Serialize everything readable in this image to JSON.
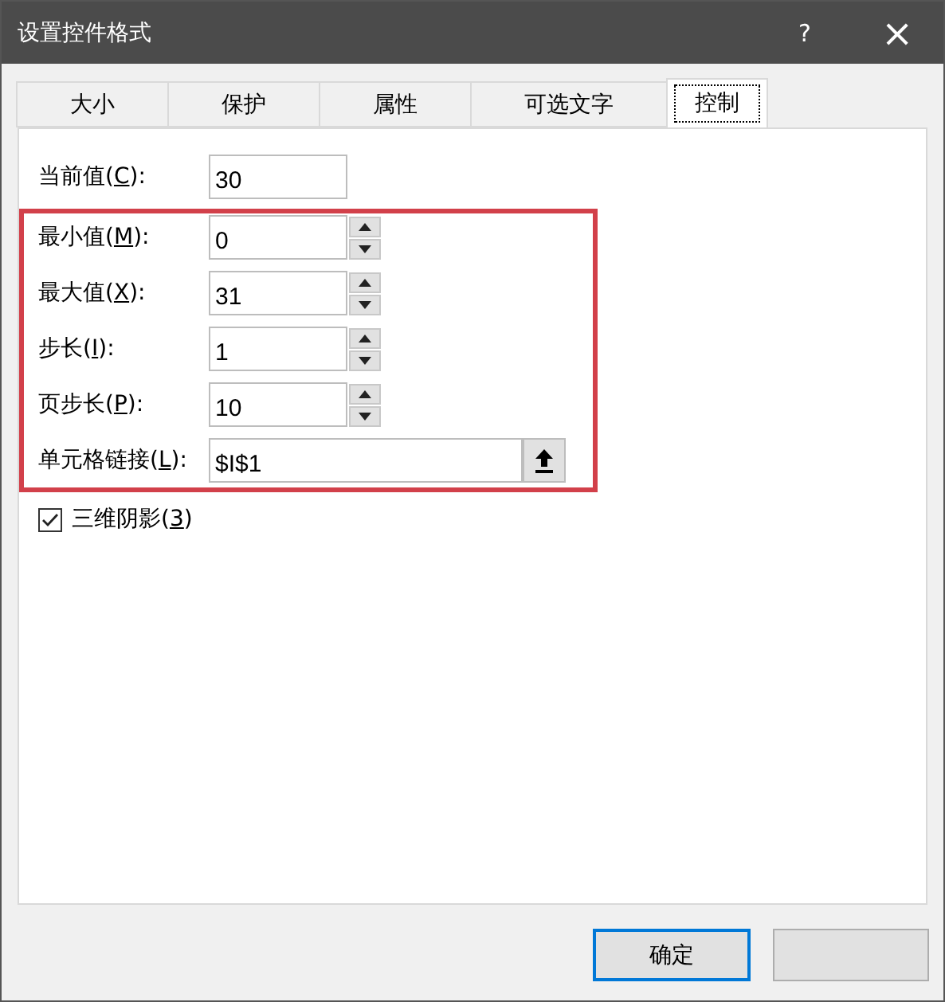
{
  "window": {
    "title": "设置控件格式",
    "help": "?",
    "close": "×"
  },
  "tabs": [
    {
      "label": "大小",
      "selected": false
    },
    {
      "label": "保护",
      "selected": false
    },
    {
      "label": "属性",
      "selected": false
    },
    {
      "label": "可选文字",
      "selected": false
    },
    {
      "label": "控制",
      "selected": true
    }
  ],
  "fields": [
    {
      "kind": "plain",
      "label": "当前值(",
      "key": "C",
      "after": "):",
      "value": "30",
      "highlighted": false
    },
    {
      "kind": "spin",
      "label": "最小值(",
      "key": "M",
      "after": "):",
      "value": "0",
      "highlighted": true
    },
    {
      "kind": "spin",
      "label": "最大值(",
      "key": "X",
      "after": "):",
      "value": "31",
      "highlighted": true
    },
    {
      "kind": "spin",
      "label": "步长(",
      "key": "I",
      "after": "):",
      "value": "1",
      "highlighted": true
    },
    {
      "kind": "spin",
      "label": "页步长(",
      "key": "P",
      "after": "):",
      "value": "10",
      "highlighted": true
    },
    {
      "kind": "ref",
      "label": "单元格链接(",
      "key": "L",
      "after": "):",
      "value": "$I$1",
      "highlighted": true
    }
  ],
  "shading": {
    "label": "三维阴影(",
    "key": "3",
    "after": ")",
    "checked": true
  },
  "buttons": [
    {
      "label": "确定",
      "default": true
    },
    {
      "default": false
    }
  ]
}
